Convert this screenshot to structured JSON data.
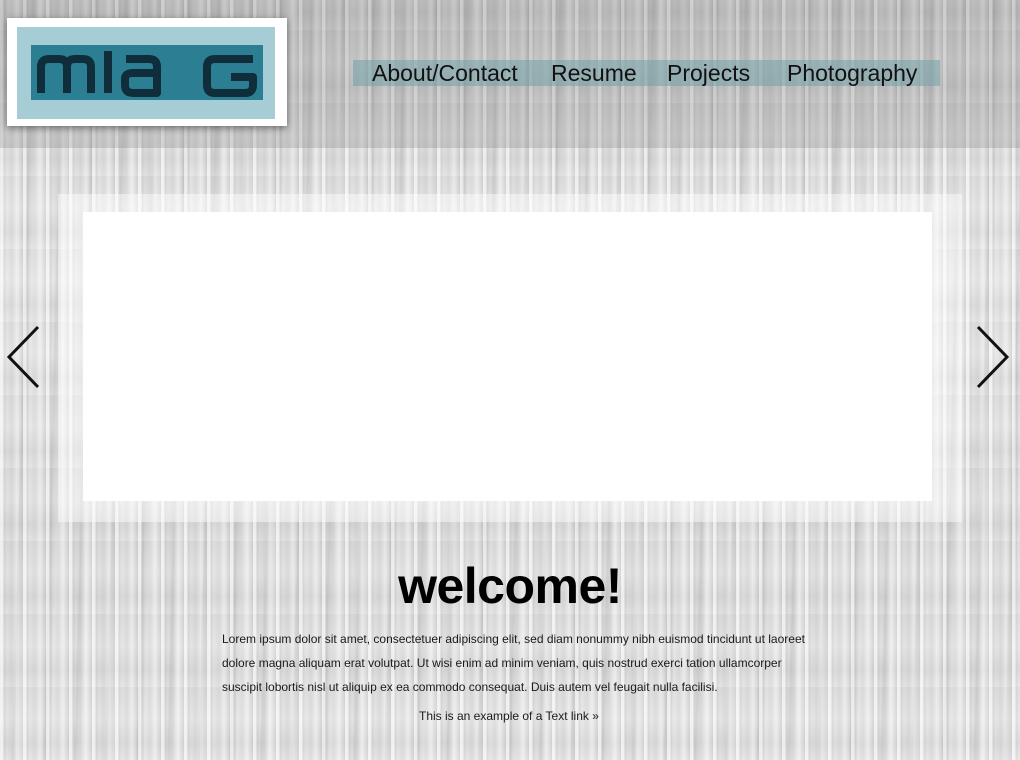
{
  "logo": {
    "text": "mIa G",
    "colors": {
      "outer": "#ffffff",
      "mat": "#a6ccd5",
      "plate": "#2c7f93",
      "letters": "#0f2d3a"
    }
  },
  "nav": {
    "items": [
      {
        "label": "About/Contact"
      },
      {
        "label": "Resume"
      },
      {
        "label": "Projects"
      },
      {
        "label": "Photography"
      }
    ],
    "bar_color": "#73a0a8"
  },
  "slider": {
    "prev_icon": "chevron-left-icon",
    "next_icon": "chevron-right-icon"
  },
  "main": {
    "heading": "welcome!",
    "paragraph": "Lorem ipsum dolor sit amet, consectetuer adipiscing elit, sed diam nonummy nibh euismod tincidunt ut laoreet dolore magna aliquam erat volutpat. Ut wisi enim ad minim veniam, quis nostrud exerci tation ullamcorper suscipit lobortis nisl ut aliquip ex ea commodo consequat. Duis autem vel feugait nulla facilisi.",
    "link_prefix": "This is an example of a ",
    "link_text": "Text link »"
  }
}
